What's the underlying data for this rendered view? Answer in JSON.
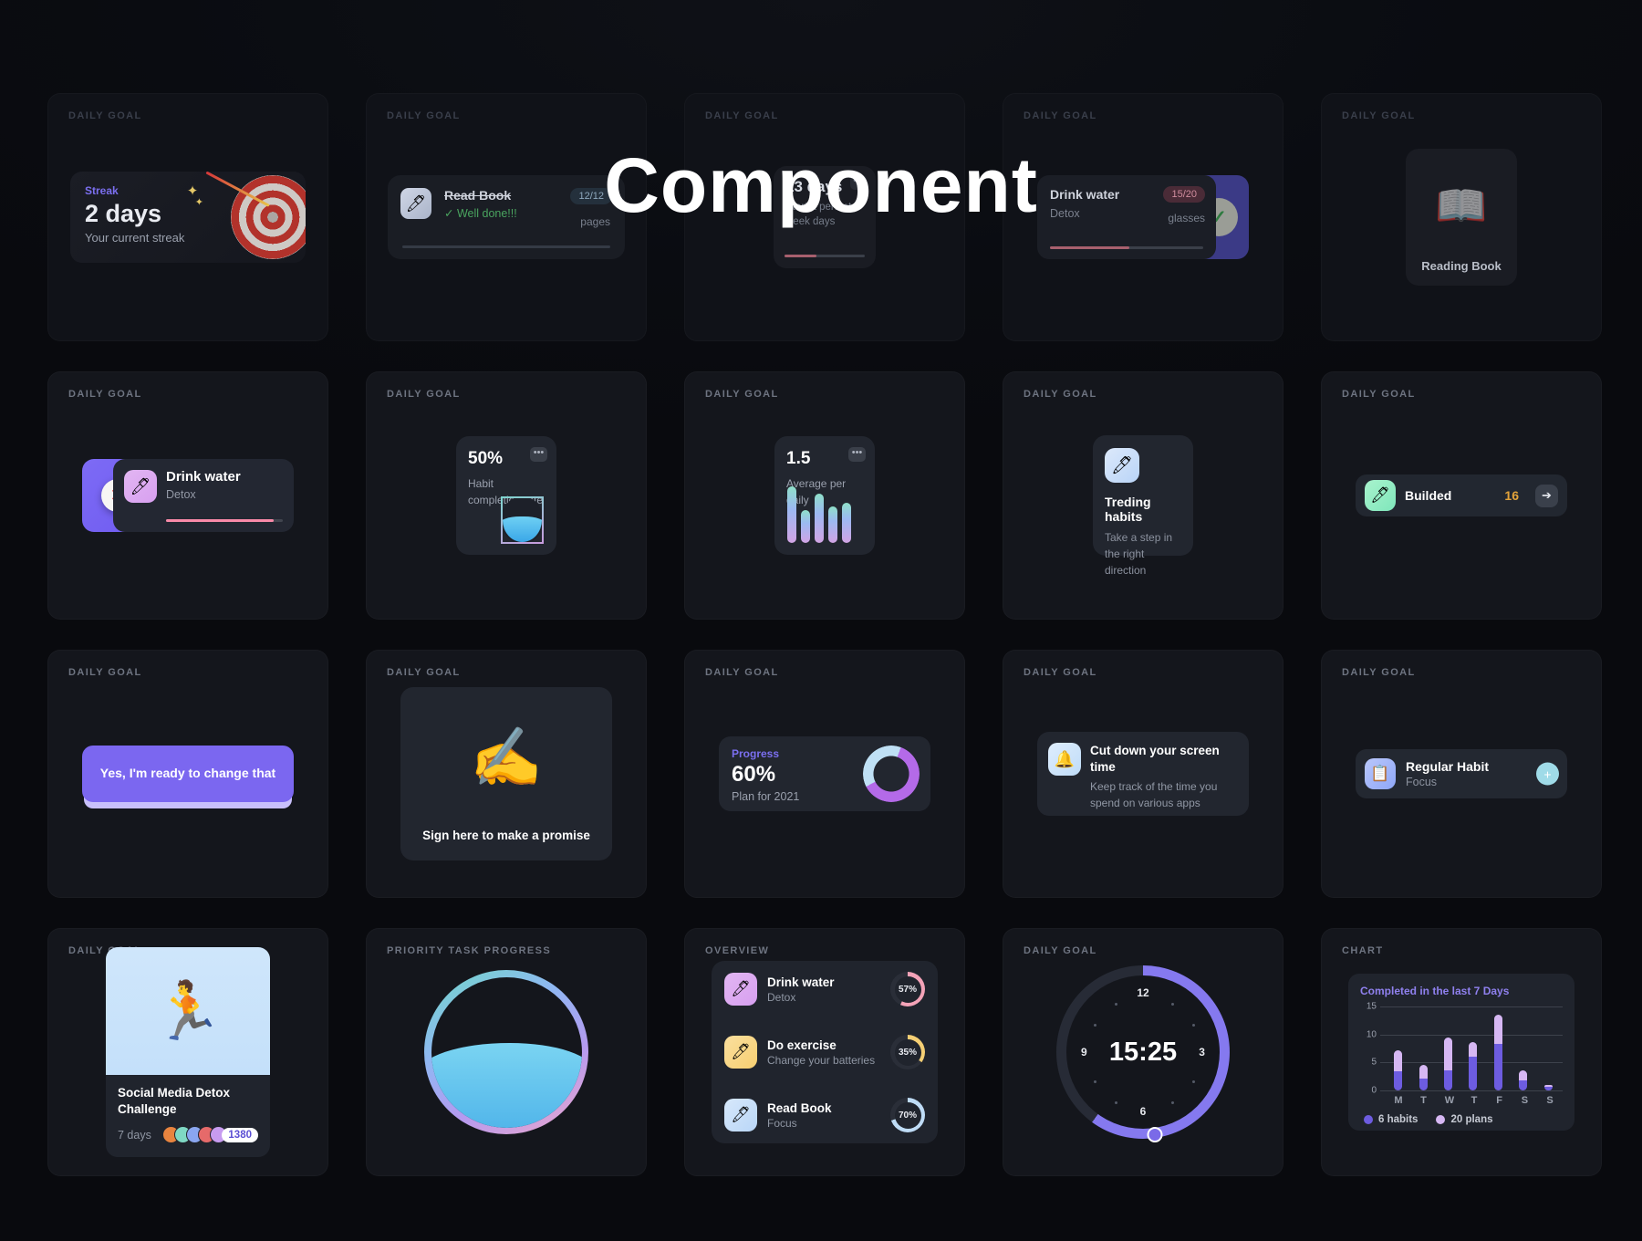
{
  "title": "Component",
  "labels": {
    "daily_goal": "DAILY GOAL",
    "priority_task_progress": "PRIORITY TASK PROGRESS",
    "overview": "OVERVIEW",
    "chart": "CHART"
  },
  "row1": {
    "streak": {
      "label": "Streak",
      "value": "2 days",
      "sub": "Your current streak",
      "icon": "target-icon",
      "sparkle_icon": "sparkles-icon"
    },
    "read_book": {
      "title": "Read Book",
      "status": "Well done!!!",
      "check_icon": "check-icon",
      "badge": "12/12",
      "unit": "pages",
      "icon": "pencil-cup-icon"
    },
    "days": {
      "value": "13 days",
      "sub": "Start a perfect week days",
      "menu_icon": "more-icon"
    },
    "drink_water": {
      "title": "Drink water",
      "subtitle": "Detox",
      "badge": "15/20",
      "unit": "glasses",
      "check_icon": "check-icon"
    },
    "reading_book": {
      "caption": "Reading Book",
      "icon": "person-reading-icon"
    }
  },
  "row2": {
    "drink_water": {
      "title": "Drink water",
      "subtitle": "Detox",
      "close_icon": "close-icon",
      "icon": "pencil-cup-icon",
      "progress": 92
    },
    "habit_rate": {
      "value": "50%",
      "sub": "Habit completion rate",
      "menu_icon": "more-icon",
      "icon": "water-blob-icon"
    },
    "average": {
      "value": "1.5",
      "sub": "Average per daily",
      "menu_icon": "more-icon",
      "bars": [
        62,
        36,
        54,
        40,
        44
      ]
    },
    "trending": {
      "title": "Treding habits",
      "sub": "Take a step in the right direction",
      "icon": "pencil-cup-icon"
    },
    "builded": {
      "title": "Builded",
      "count": "16",
      "arrow_icon": "arrow-right-icon",
      "icon": "pencil-cup-icon"
    }
  },
  "row3": {
    "cta": {
      "label": "Yes, I'm ready to change that"
    },
    "sign": {
      "caption": "Sign here to make a promise",
      "icon": "writing-hand-icon"
    },
    "progress": {
      "label": "Progress",
      "value": "60%",
      "sub": "Plan for 2021",
      "icon": "donut-chart-icon"
    },
    "screen_time": {
      "title": "Cut down your screen time",
      "sub": "Keep track of the time you spend on various apps",
      "icon": "bell-icon"
    },
    "regular_habit": {
      "title": "Regular  Habit",
      "subtitle": "Focus",
      "plus_icon": "plus-icon",
      "icon": "checklist-icon"
    }
  },
  "row4": {
    "challenge": {
      "title": "Social Media Detox Challenge",
      "days": "7 days",
      "count": "1380",
      "icon": "person-phone-icon",
      "avatar_colors": [
        "#e8843f",
        "#7fd8c4",
        "#8aa6f0",
        "#e66a6a",
        "#c79bf0"
      ]
    },
    "water_circle": {
      "icon": "water-fill-icon"
    },
    "overview_items": [
      {
        "title": "Drink water",
        "sub": "Detox",
        "pct": "57%",
        "value": 57,
        "color": "#f4a3b8",
        "icon_bg": "linear-gradient(135deg,#e2b6f2,#d79ff0)",
        "icon": "pencil-cup-icon"
      },
      {
        "title": "Do exercise",
        "sub": "Change your batteries",
        "pct": "35%",
        "value": 35,
        "color": "#f5cf74",
        "icon_bg": "linear-gradient(135deg,#fadf9e,#f7cf71)",
        "icon": "plant-icon"
      },
      {
        "title": "Read Book",
        "sub": "Focus",
        "pct": "70%",
        "value": 70,
        "color": "#bfdcf6",
        "icon_bg": "linear-gradient(135deg,#d7e8fb,#b9d6f7)",
        "icon": "pencil-cup-icon"
      }
    ],
    "clock": {
      "time": "15:25",
      "numbers": [
        "12",
        "3",
        "6",
        "9"
      ],
      "progress": 60
    }
  },
  "chart_data": {
    "type": "bar",
    "title": "Completed in the last 7 Days",
    "categories": [
      "M",
      "T",
      "W",
      "T",
      "F",
      "S",
      "S"
    ],
    "series": [
      {
        "name": "6 habits",
        "color": "#6d5ce0",
        "values": [
          3.5,
          2.2,
          3.6,
          6.1,
          8.3,
          1.8,
          0.6
        ]
      },
      {
        "name": "20 plans",
        "color": "#d6b7f3",
        "values": [
          7.1,
          4.6,
          9.4,
          8.6,
          13.6,
          3.6,
          1.0
        ]
      }
    ],
    "stacked": false,
    "ylim": [
      0,
      15
    ],
    "yticks": [
      0,
      5,
      10,
      15
    ],
    "xlabel": "",
    "ylabel": "",
    "grid": true,
    "legend": [
      "6 habits",
      "20 plans"
    ],
    "legend_position": "bottom-left"
  }
}
